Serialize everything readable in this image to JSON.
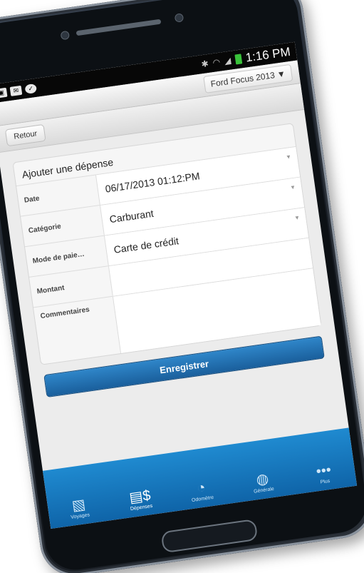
{
  "status_bar": {
    "left_icons": [
      "image-icon",
      "mail-icon",
      "check-icon"
    ],
    "right_icons": [
      "bluetooth-icon",
      "wifi-icon",
      "signal-icon",
      "battery-icon"
    ],
    "time": "1:16 PM"
  },
  "top_bar": {
    "vehicle_select": "Ford Focus 2013 ▼"
  },
  "nav": {
    "back_label": "Retour"
  },
  "form": {
    "title": "Ajouter une dépense",
    "fields": [
      {
        "label": "Date",
        "value": "06/17/2013 01:12:PM"
      },
      {
        "label": "Catégorie",
        "value": "Carburant"
      },
      {
        "label": "Mode de paie…",
        "value": "Carte de crédit"
      },
      {
        "label": "Montant",
        "value": ""
      },
      {
        "label": "Commentaires",
        "value": ""
      }
    ],
    "save_label": "Enregistrer"
  },
  "tabs": [
    {
      "label": "Voyages",
      "icon": "map-icon",
      "glyph": "▧",
      "active": false
    },
    {
      "label": "Dépenses",
      "icon": "expenses-icon",
      "glyph": "▤$",
      "active": true
    },
    {
      "label": "Odomètre",
      "icon": "speedometer-icon",
      "glyph": "◔",
      "active": false
    },
    {
      "label": "Générale",
      "icon": "globe-icon",
      "glyph": "◍",
      "active": false
    },
    {
      "label": "Plus",
      "icon": "more-icon",
      "glyph": "•••",
      "active": false
    }
  ],
  "colors": {
    "accent": "#1a6fb5",
    "status_bar": "#070707",
    "tab_bar": "#1878c0"
  }
}
